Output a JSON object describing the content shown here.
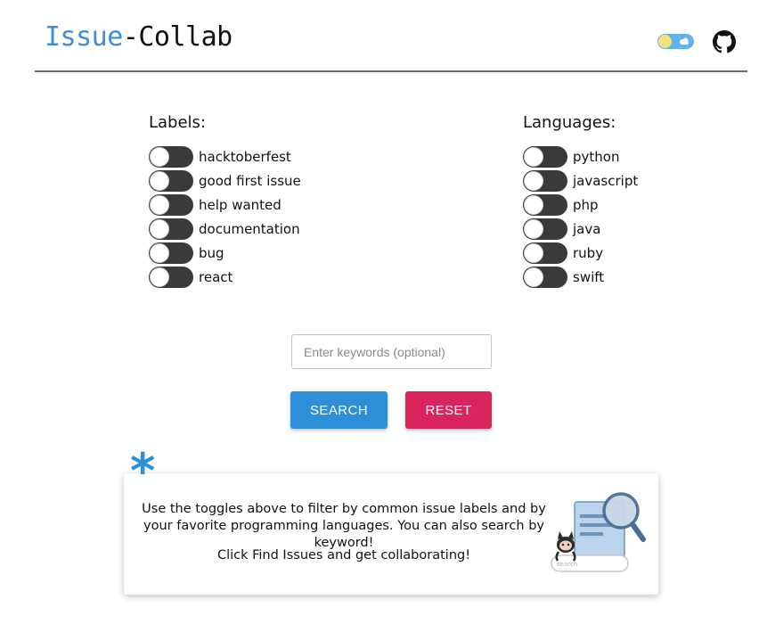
{
  "header": {
    "logo_part1": "Issue",
    "logo_part2": "-Collab"
  },
  "labels": {
    "title": "Labels:",
    "items": [
      {
        "label": "hacktoberfest",
        "on": false
      },
      {
        "label": "good first issue",
        "on": false
      },
      {
        "label": "help wanted",
        "on": false
      },
      {
        "label": "documentation",
        "on": false
      },
      {
        "label": "bug",
        "on": false
      },
      {
        "label": "react",
        "on": false
      }
    ]
  },
  "languages": {
    "title": "Languages:",
    "items": [
      {
        "label": "python",
        "on": false
      },
      {
        "label": "javascript",
        "on": false
      },
      {
        "label": "php",
        "on": false
      },
      {
        "label": "java",
        "on": false
      },
      {
        "label": "ruby",
        "on": false
      },
      {
        "label": "swift",
        "on": false
      }
    ]
  },
  "search": {
    "placeholder": "Enter keywords (optional)",
    "value": ""
  },
  "buttons": {
    "search_label": "SEARCH",
    "reset_label": "RESET"
  },
  "info_card": {
    "asterisk": "*",
    "line1": "Use the toggles above to filter by common issue labels and by your favorite programming languages. You can also search by keyword!",
    "line2": "Click Find Issues and get collaborating!",
    "illustration_search_text": "search"
  },
  "colors": {
    "brand_blue": "#2e8fd9",
    "reset_red": "#d9245c",
    "toggle_off": "#3a3a3a"
  },
  "icons": {
    "theme_toggle": "sun-cloud-toggle-icon",
    "github": "github-icon"
  }
}
